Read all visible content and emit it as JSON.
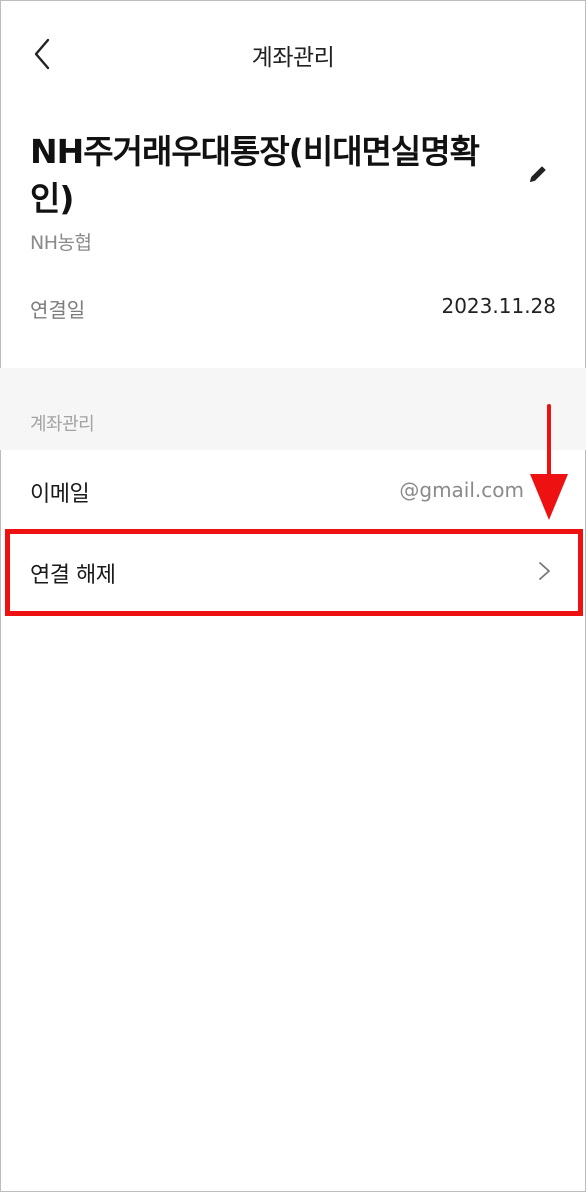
{
  "header": {
    "back_icon": "chevron-left-icon",
    "title": "계좌관리"
  },
  "account": {
    "name": "NH주거래우대통장(비대면실명확인)",
    "edit_icon": "pencil-icon",
    "bank": "NH농협",
    "linked_date_label": "연결일",
    "linked_date_value": "2023.11.28"
  },
  "section": {
    "label": "계좌관리"
  },
  "rows": {
    "email_label": "이메일",
    "email_value": "@gmail.com",
    "disconnect_label": "연결 해제",
    "disconnect_icon": "chevron-right-icon"
  },
  "annotation": {
    "color": "#ee1111",
    "arrow_icon": "arrow-down-icon"
  }
}
